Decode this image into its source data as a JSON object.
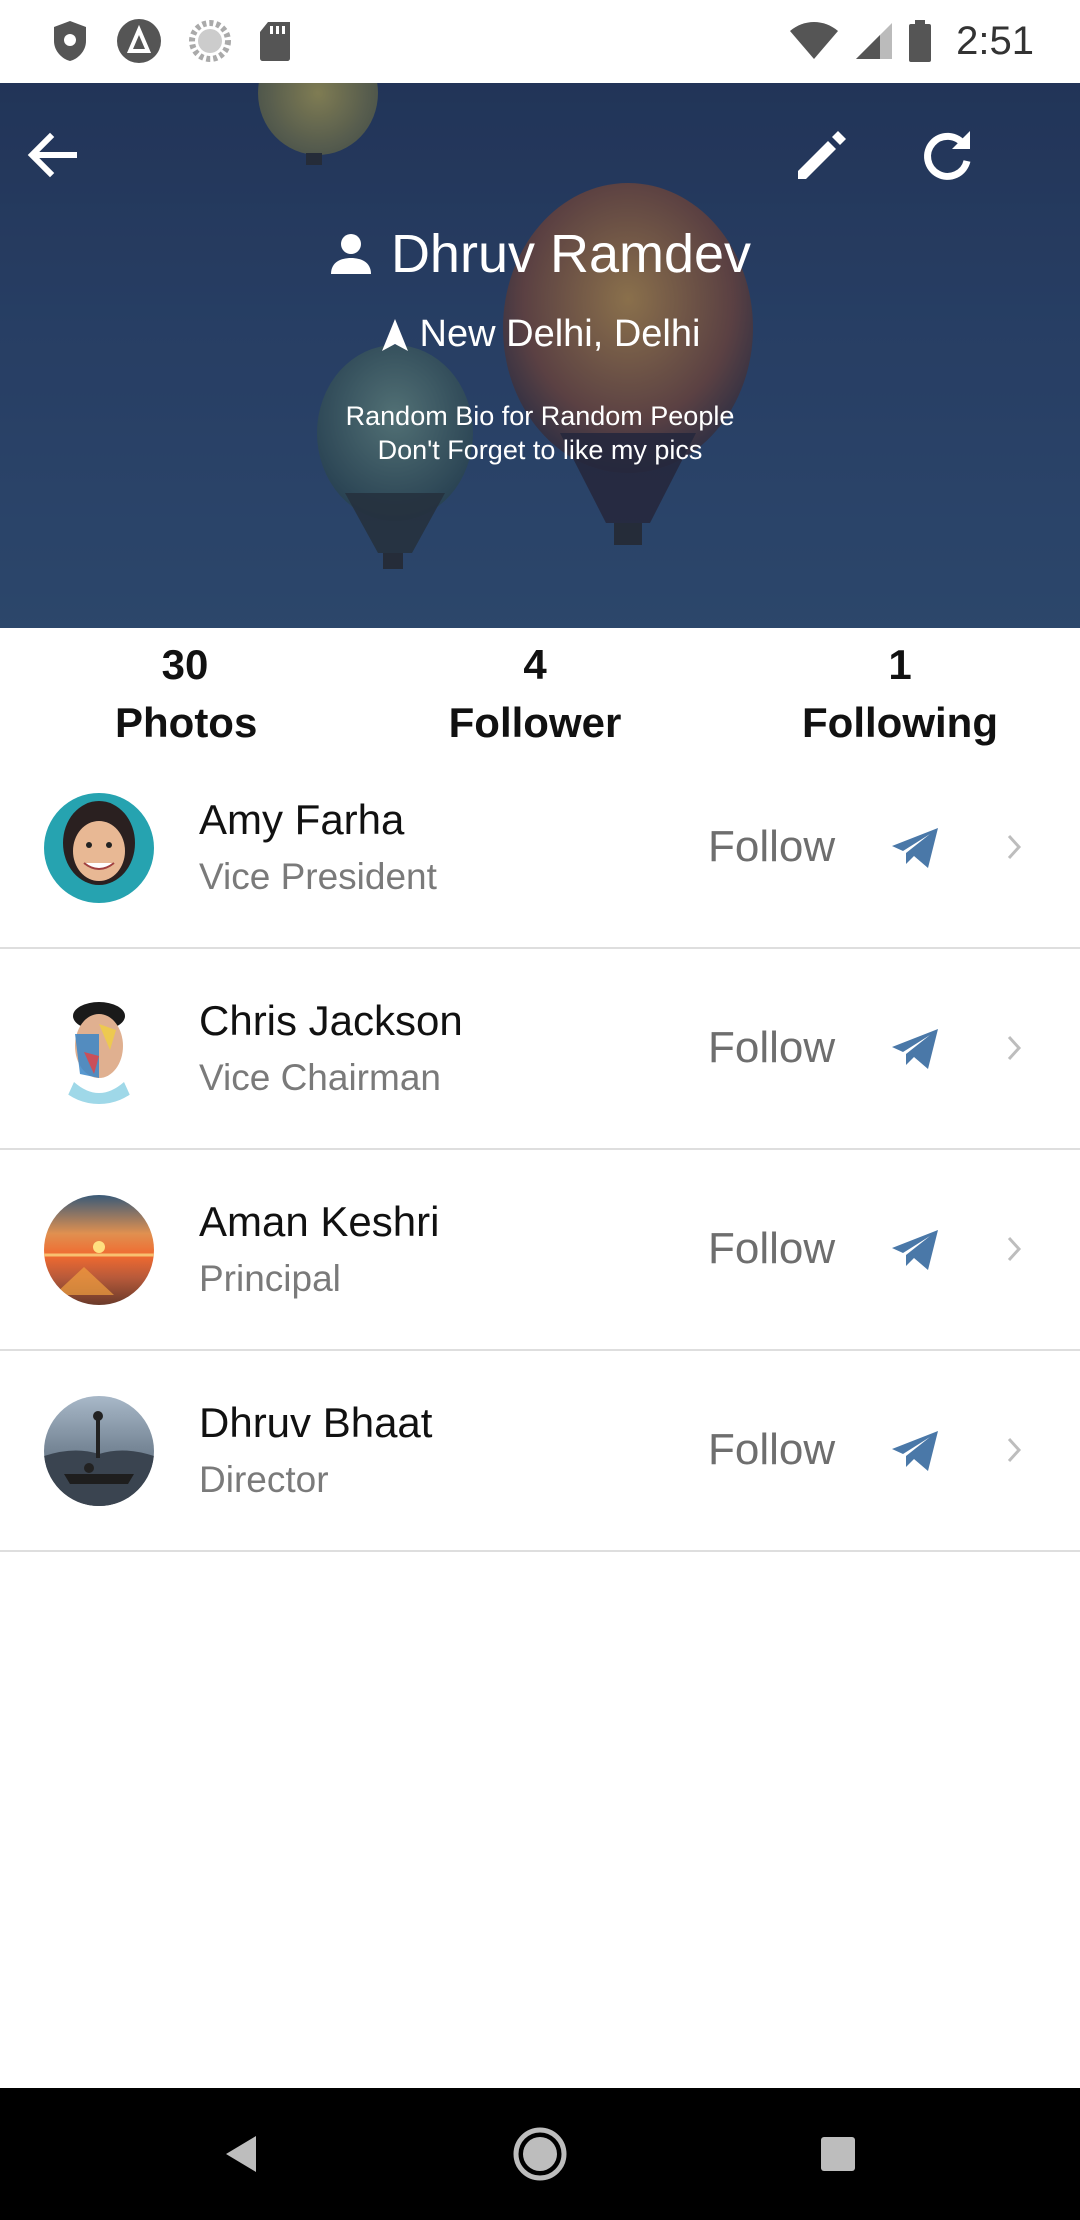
{
  "status_bar": {
    "time": "2:51",
    "left_icons": [
      "shield-icon",
      "autofill-icon",
      "sync-icon",
      "sd-card-icon"
    ],
    "right_icons": [
      "wifi-icon",
      "signal-icon",
      "battery-icon"
    ]
  },
  "profile": {
    "name": "Dhruv Ramdev",
    "location": "New Delhi, Delhi",
    "bio_line1": "Random Bio for Random People",
    "bio_line2": "Don't Forget to like my pics"
  },
  "stats": [
    {
      "value": "30",
      "label": "Photos"
    },
    {
      "value": "4",
      "label": "Follower"
    },
    {
      "value": "1",
      "label": "Following"
    }
  ],
  "people": [
    {
      "name": "Amy Farha",
      "title": "Vice President",
      "action": "Follow"
    },
    {
      "name": "Chris Jackson",
      "title": "Vice Chairman",
      "action": "Follow"
    },
    {
      "name": "Aman Keshri",
      "title": "Principal",
      "action": "Follow"
    },
    {
      "name": "Dhruv Bhaat",
      "title": "Director",
      "action": "Follow"
    }
  ],
  "colors": {
    "header_bg": "#34507b",
    "send_icon": "#4a78a8",
    "secondary_text": "#7a7a7a",
    "navbar_bg": "#000000"
  }
}
